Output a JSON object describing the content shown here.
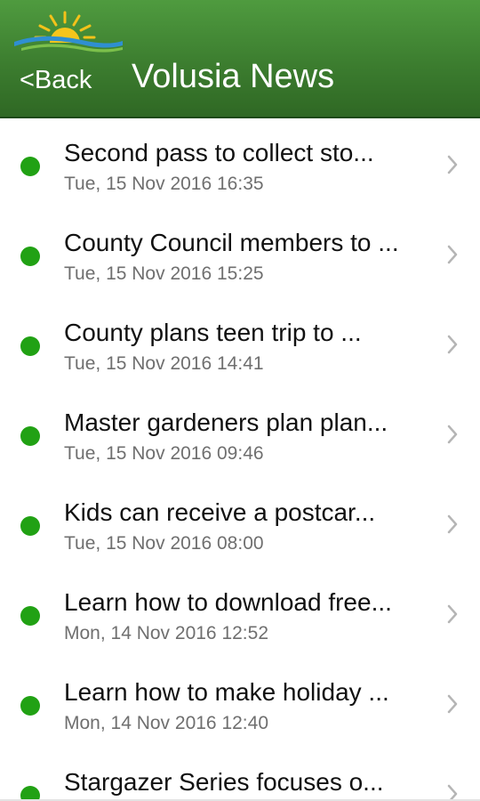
{
  "header": {
    "back_label": "<Back",
    "title": "Volusia News",
    "logo_icon": "sun-over-waves-logo"
  },
  "colors": {
    "header_green": "#3c7d2f",
    "status_dot": "#21a114",
    "date_text": "#6f6f6f",
    "chevron": "#b5b5b5"
  },
  "news": {
    "items": [
      {
        "title": "Second pass to collect sto...",
        "date": "Tue, 15 Nov 2016 16:35"
      },
      {
        "title": "County Council members to ...",
        "date": "Tue, 15 Nov 2016 15:25"
      },
      {
        "title": "County plans teen trip to ...",
        "date": "Tue, 15 Nov 2016 14:41"
      },
      {
        "title": "Master gardeners plan plan...",
        "date": "Tue, 15 Nov 2016 09:46"
      },
      {
        "title": "Kids can receive a postcar...",
        "date": "Tue, 15 Nov 2016 08:00"
      },
      {
        "title": "Learn how to download free...",
        "date": "Mon, 14 Nov 2016 12:52"
      },
      {
        "title": "Learn how to make holiday ...",
        "date": "Mon, 14 Nov 2016 12:40"
      },
      {
        "title": "Stargazer Series focuses o...",
        "date": ""
      }
    ]
  }
}
